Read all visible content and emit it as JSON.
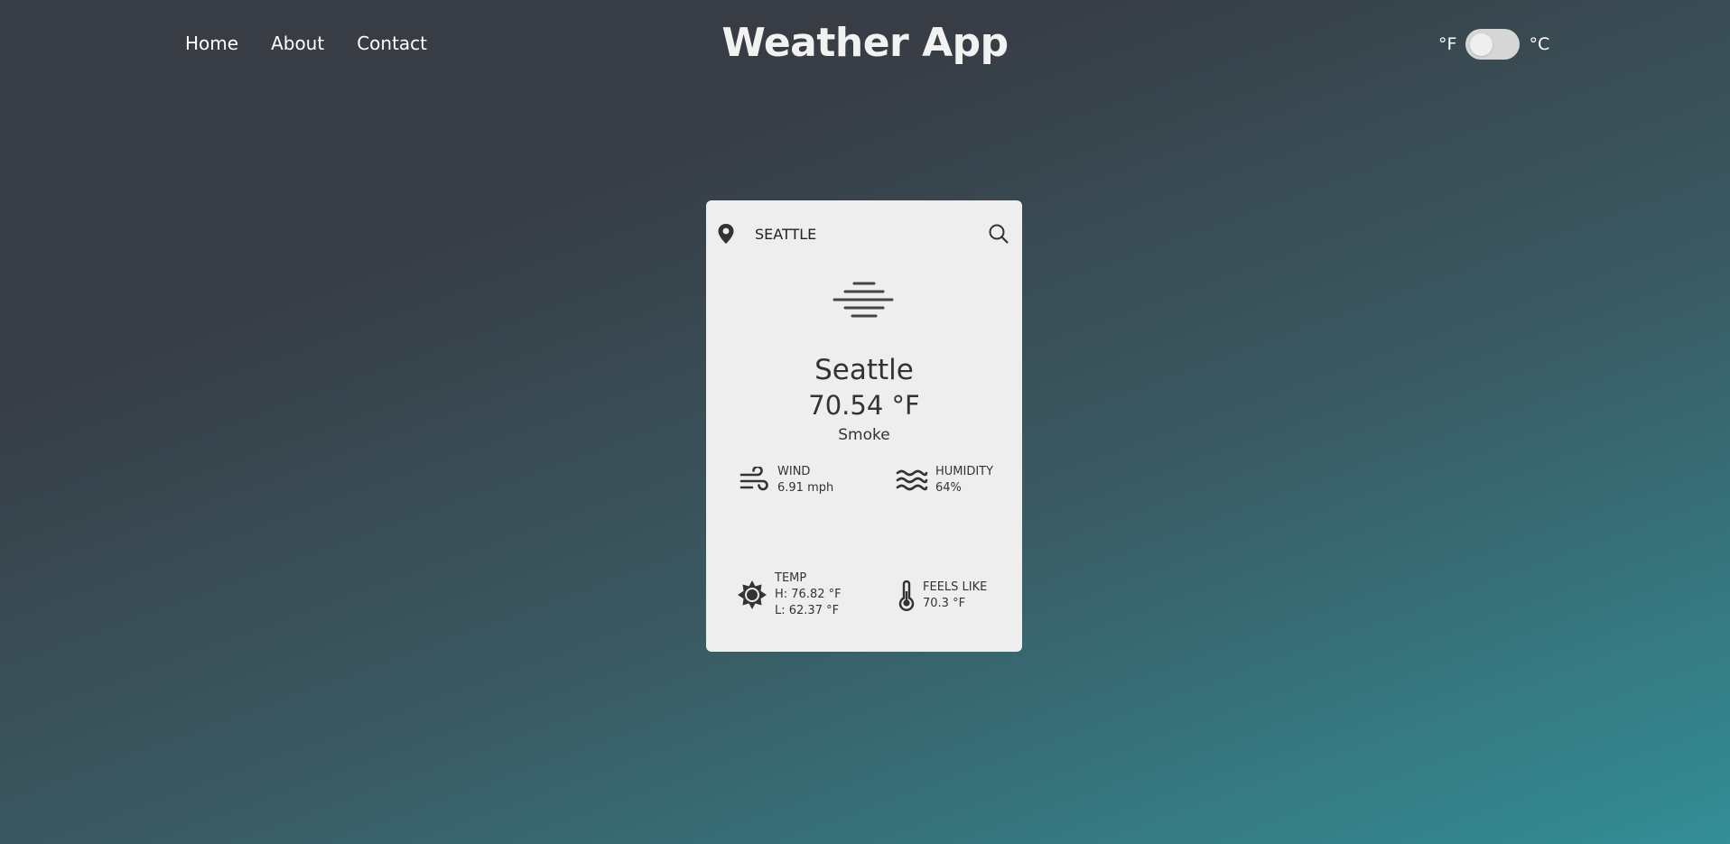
{
  "nav": {
    "home": "Home",
    "about": "About",
    "contact": "Contact"
  },
  "header": {
    "title": "Weather App"
  },
  "units": {
    "fahrenheit_label": "°F",
    "celsius_label": "°C",
    "selected": "°F"
  },
  "search": {
    "value": "SEATTLE"
  },
  "weather": {
    "icon": "fog-icon",
    "city": "Seattle",
    "temperature": "70.54 °F",
    "description": "Smoke"
  },
  "stats": {
    "wind_label": "WIND",
    "wind_value": "6.91 mph",
    "humidity_label": "HUMIDITY",
    "humidity_value": "64%",
    "temp_label": "TEMP",
    "temp_high": "H: 76.82 °F",
    "temp_low": "L: 62.37 °F",
    "feels_label": "FEELS LIKE",
    "feels_value": "70.3 °F"
  },
  "colors": {
    "card_background": "#eeeeee",
    "icon_color": "#333333",
    "gradient_start": "#383c45",
    "gradient_end": "#338e96"
  }
}
